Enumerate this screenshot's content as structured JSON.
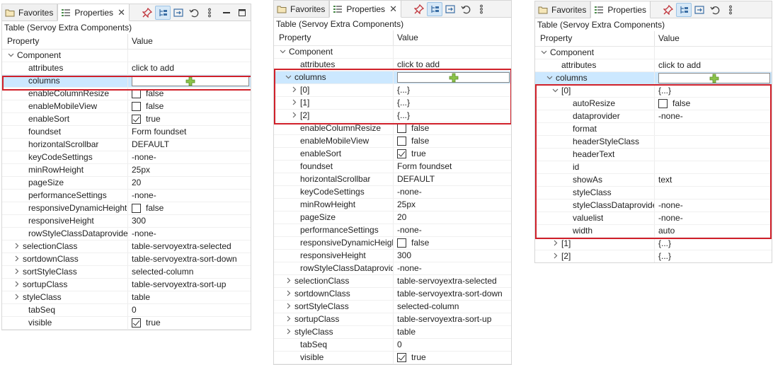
{
  "common": {
    "tabs": {
      "favorites": "Favorites",
      "properties": "Properties",
      "close": "✕"
    },
    "title": "Table (Servoy Extra Components)",
    "headers": {
      "property": "Property",
      "value": "Value"
    },
    "colors": {
      "selection": "#cce8ff",
      "highlight": "#d0202a",
      "toolbar_pressed": "#d6e8f7"
    }
  },
  "panel1": {
    "rows": [
      {
        "label": "Component",
        "value": "",
        "expander": "expanded",
        "indent": 0
      },
      {
        "label": "attributes",
        "value": "click to add",
        "indent": 2
      },
      {
        "label": "columns",
        "value": "",
        "indent": 2,
        "kind": "add",
        "selected": true
      },
      {
        "label": "enableColumnResize",
        "value": "false",
        "indent": 2,
        "checkbox": "unchecked"
      },
      {
        "label": "enableMobileView",
        "value": "false",
        "indent": 2,
        "checkbox": "unchecked"
      },
      {
        "label": "enableSort",
        "value": "true",
        "indent": 2,
        "checkbox": "checked"
      },
      {
        "label": "foundset",
        "value": "Form foundset",
        "indent": 2
      },
      {
        "label": "horizontalScrollbar",
        "value": "DEFAULT",
        "indent": 2
      },
      {
        "label": "keyCodeSettings",
        "value": "-none-",
        "indent": 2
      },
      {
        "label": "minRowHeight",
        "value": "25px",
        "indent": 2
      },
      {
        "label": "pageSize",
        "value": "20",
        "indent": 2
      },
      {
        "label": "performanceSettings",
        "value": "-none-",
        "indent": 2
      },
      {
        "label": "responsiveDynamicHeight",
        "value": "false",
        "indent": 2,
        "checkbox": "unchecked"
      },
      {
        "label": "responsiveHeight",
        "value": "300",
        "indent": 2
      },
      {
        "label": "rowStyleClassDataprovider",
        "value": "-none-",
        "indent": 2
      },
      {
        "label": "selectionClass",
        "value": "table-servoyextra-selected",
        "expander": "collapsed",
        "indent": 1
      },
      {
        "label": "sortdownClass",
        "value": "table-servoyextra-sort-down",
        "expander": "collapsed",
        "indent": 1
      },
      {
        "label": "sortStyleClass",
        "value": "selected-column",
        "expander": "collapsed",
        "indent": 1
      },
      {
        "label": "sortupClass",
        "value": "table-servoyextra-sort-up",
        "expander": "collapsed",
        "indent": 1
      },
      {
        "label": "styleClass",
        "value": "table",
        "expander": "collapsed",
        "indent": 1
      },
      {
        "label": "tabSeq",
        "value": "0",
        "indent": 2
      },
      {
        "label": "visible",
        "value": "true",
        "indent": 2,
        "checkbox": "checked"
      }
    ]
  },
  "panel2": {
    "rows": [
      {
        "label": "Component",
        "value": "",
        "expander": "expanded",
        "indent": 0
      },
      {
        "label": "attributes",
        "value": "click to add",
        "indent": 2
      },
      {
        "label": "columns",
        "value": "",
        "expander": "expanded",
        "indent": 1,
        "kind": "add",
        "selected": true
      },
      {
        "label": "[0]",
        "value": "{...}",
        "expander": "collapsed",
        "indent": 2
      },
      {
        "label": "[1]",
        "value": "{...}",
        "expander": "collapsed",
        "indent": 2
      },
      {
        "label": "[2]",
        "value": "{...}",
        "expander": "collapsed",
        "indent": 2
      },
      {
        "label": "enableColumnResize",
        "value": "false",
        "indent": 2,
        "checkbox": "unchecked"
      },
      {
        "label": "enableMobileView",
        "value": "false",
        "indent": 2,
        "checkbox": "unchecked"
      },
      {
        "label": "enableSort",
        "value": "true",
        "indent": 2,
        "checkbox": "checked"
      },
      {
        "label": "foundset",
        "value": "Form foundset",
        "indent": 2
      },
      {
        "label": "horizontalScrollbar",
        "value": "DEFAULT",
        "indent": 2
      },
      {
        "label": "keyCodeSettings",
        "value": "-none-",
        "indent": 2
      },
      {
        "label": "minRowHeight",
        "value": "25px",
        "indent": 2
      },
      {
        "label": "pageSize",
        "value": "20",
        "indent": 2
      },
      {
        "label": "performanceSettings",
        "value": "-none-",
        "indent": 2
      },
      {
        "label": "responsiveDynamicHeight",
        "value": "false",
        "indent": 2,
        "checkbox": "unchecked"
      },
      {
        "label": "responsiveHeight",
        "value": "300",
        "indent": 2
      },
      {
        "label": "rowStyleClassDataprovider",
        "value": "-none-",
        "indent": 2
      },
      {
        "label": "selectionClass",
        "value": "table-servoyextra-selected",
        "expander": "collapsed",
        "indent": 1
      },
      {
        "label": "sortdownClass",
        "value": "table-servoyextra-sort-down",
        "expander": "collapsed",
        "indent": 1
      },
      {
        "label": "sortStyleClass",
        "value": "selected-column",
        "expander": "collapsed",
        "indent": 1
      },
      {
        "label": "sortupClass",
        "value": "table-servoyextra-sort-up",
        "expander": "collapsed",
        "indent": 1
      },
      {
        "label": "styleClass",
        "value": "table",
        "expander": "collapsed",
        "indent": 1
      },
      {
        "label": "tabSeq",
        "value": "0",
        "indent": 2
      },
      {
        "label": "visible",
        "value": "true",
        "indent": 2,
        "checkbox": "checked"
      }
    ]
  },
  "panel3": {
    "rows": [
      {
        "label": "Component",
        "value": "",
        "expander": "expanded",
        "indent": 0
      },
      {
        "label": "attributes",
        "value": "click to add",
        "indent": 2
      },
      {
        "label": "columns",
        "value": "",
        "expander": "expanded",
        "indent": 1,
        "kind": "add",
        "selected": true
      },
      {
        "label": "[0]",
        "value": "{...}",
        "expander": "expanded",
        "indent": 2
      },
      {
        "label": "autoResize",
        "value": "false",
        "indent": 4,
        "checkbox": "unchecked"
      },
      {
        "label": "dataprovider",
        "value": "-none-",
        "indent": 4
      },
      {
        "label": "format",
        "value": "",
        "indent": 4
      },
      {
        "label": "headerStyleClass",
        "value": "",
        "indent": 4
      },
      {
        "label": "headerText",
        "value": "",
        "indent": 4
      },
      {
        "label": "id",
        "value": "",
        "indent": 4
      },
      {
        "label": "showAs",
        "value": "text",
        "indent": 4
      },
      {
        "label": "styleClass",
        "value": "",
        "indent": 4
      },
      {
        "label": "styleClassDataprovider",
        "value": "-none-",
        "indent": 4
      },
      {
        "label": "valuelist",
        "value": "-none-",
        "indent": 4
      },
      {
        "label": "width",
        "value": "auto",
        "indent": 4
      },
      {
        "label": "[1]",
        "value": "{...}",
        "expander": "collapsed",
        "indent": 2
      },
      {
        "label": "[2]",
        "value": "{...}",
        "expander": "collapsed",
        "indent": 2
      }
    ]
  }
}
